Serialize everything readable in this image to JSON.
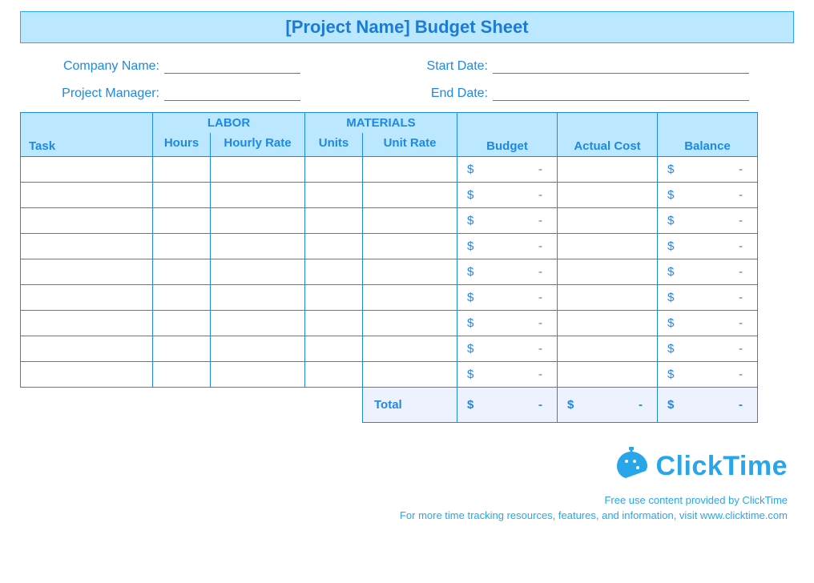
{
  "title": "[Project Name] Budget Sheet",
  "meta": {
    "company_label": "Company Name:",
    "manager_label": "Project Manager:",
    "start_label": "Start Date:",
    "end_label": "End Date:"
  },
  "headers": {
    "task": "Task",
    "labor": "LABOR",
    "materials": "MATERIALS",
    "hours": "Hours",
    "hourly_rate": "Hourly Rate",
    "units": "Units",
    "unit_rate": "Unit Rate",
    "budget": "Budget",
    "actual_cost": "Actual Cost",
    "balance": "Balance"
  },
  "currency_symbol": "$",
  "placeholder_dash": "-",
  "rows": 9,
  "totals": {
    "label": "Total"
  },
  "brand": {
    "name": "ClickTime",
    "line1": "Free use content provided by ClickTime",
    "line2": "For more time tracking resources, features, and information, visit www.clicktime.com"
  }
}
